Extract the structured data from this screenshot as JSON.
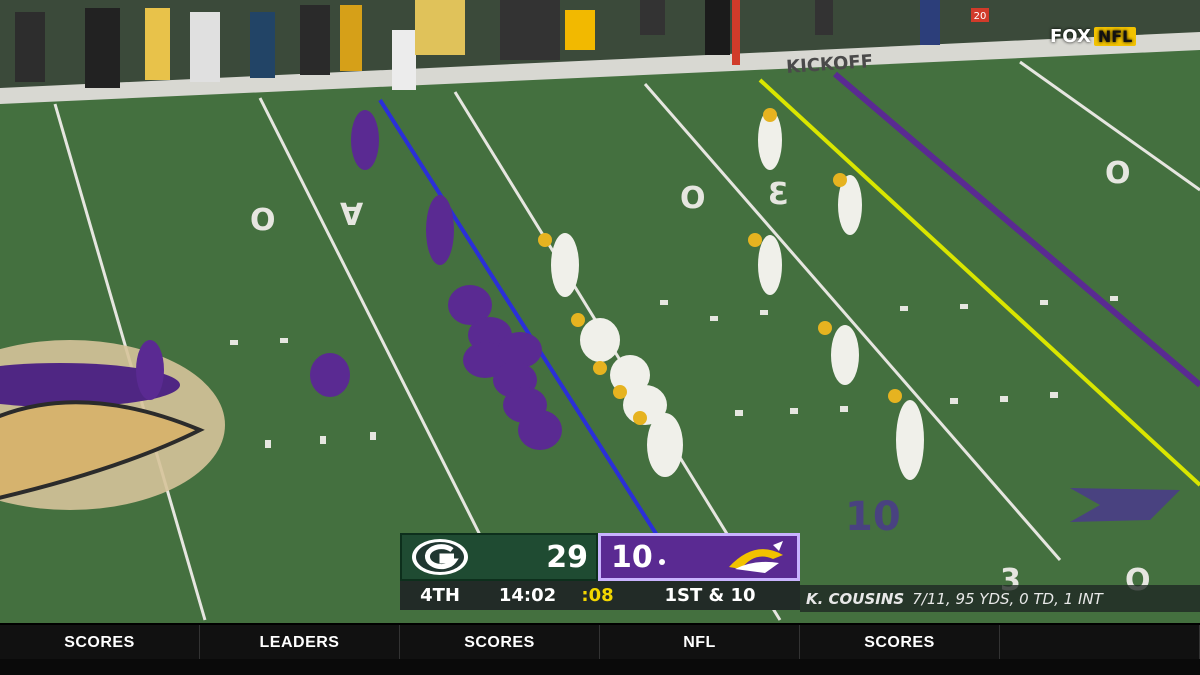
{
  "broadcast": {
    "network": "FOX",
    "league_badge": "NFL"
  },
  "scoreboard": {
    "away_team": {
      "logo": "packers-g-logo",
      "score": "29",
      "color": "#1f4b32"
    },
    "home_team": {
      "logo": "vikings-helmet-logo",
      "score": "10",
      "color": "#5a2a92"
    },
    "quarter": "4TH",
    "game_clock": "14:02",
    "play_clock": ":08",
    "down_distance": "1ST & 10"
  },
  "stat_line": {
    "player": "K. COUSINS",
    "stats": "7/11, 95 YDS, 0 TD, 1 INT"
  },
  "field_text": {
    "sideline_banner": "KICKOFF",
    "line_to_gain": "1ST & 10",
    "down_marker": "20"
  },
  "colors": {
    "turf": "#3f6b3c",
    "line_of_scrimmage": "#2b2fd8",
    "first_down_line": "#d9e600",
    "vikings_purple": "#4f2683",
    "packers_green": "#203731",
    "packers_gold": "#ffb612"
  },
  "ticker": [
    "SCORES",
    "LEADERS",
    "SCORES",
    "NFL",
    "SCORES",
    ""
  ]
}
